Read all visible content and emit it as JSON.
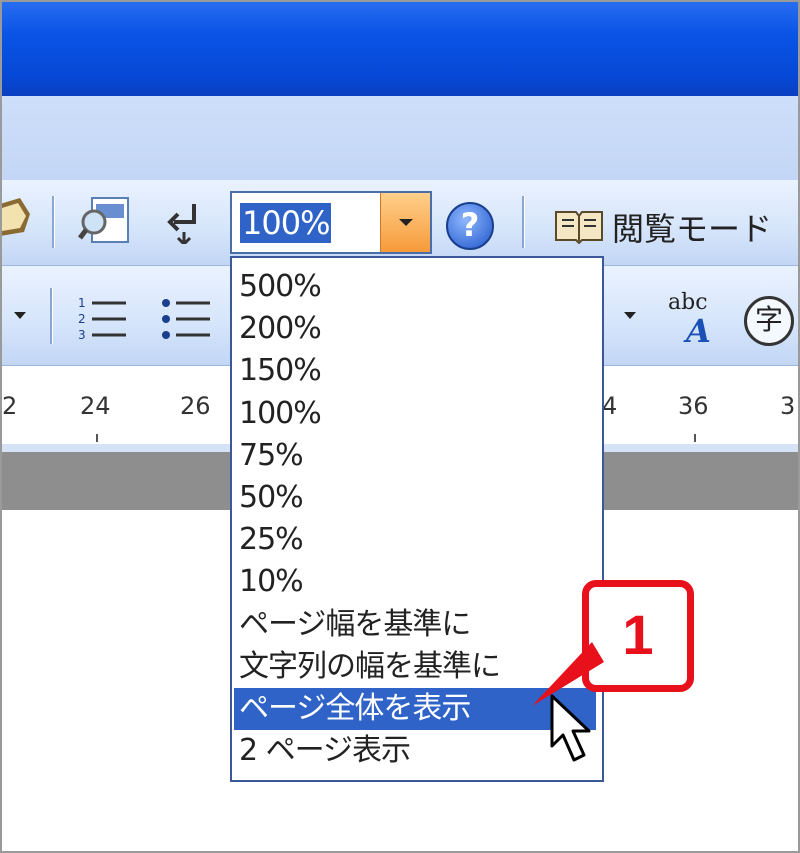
{
  "zoom": {
    "current_value": "100%",
    "options": [
      "500%",
      "200%",
      "150%",
      "100%",
      "75%",
      "50%",
      "25%",
      "10%",
      "ページ幅を基準に",
      "文字列の幅を基準に",
      "ページ全体を表示",
      "2 ページ表示"
    ],
    "selected_option": "ページ全体を表示"
  },
  "toolbar": {
    "reading_mode_label": "閲覧モード",
    "abc_label": "abc",
    "abc_sub_label": "A",
    "kanji_label": "字"
  },
  "ruler": {
    "numbers": [
      "2",
      "24",
      "26",
      "4",
      "36",
      "3"
    ]
  },
  "callout": {
    "label": "1"
  },
  "colors": {
    "title_bar": "#0a54e6",
    "selection": "#2f63c8",
    "callout_red": "#e8101a"
  }
}
